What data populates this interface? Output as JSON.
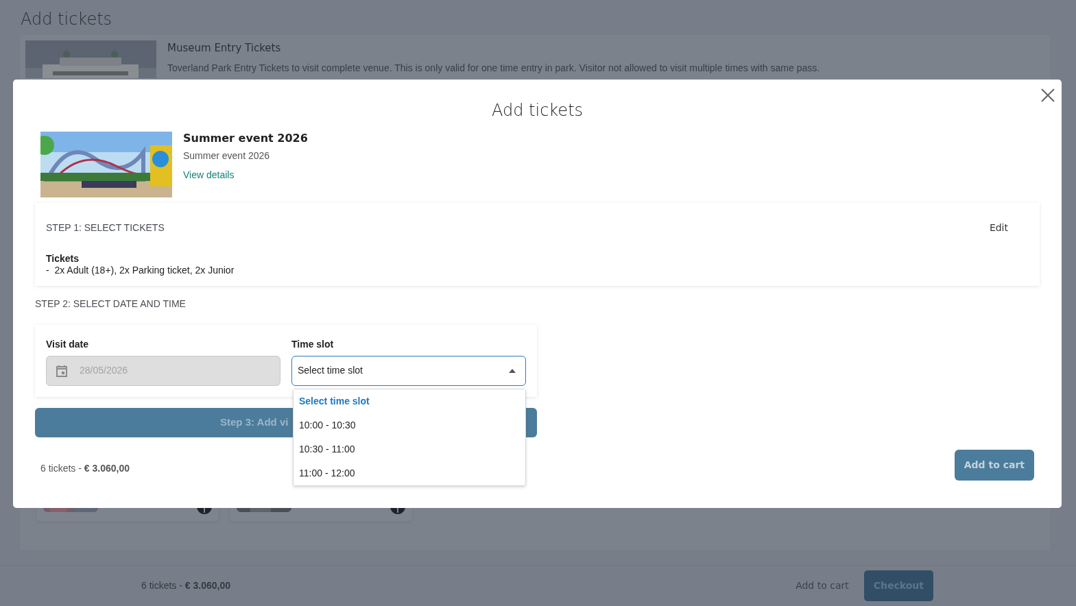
{
  "page": {
    "title": "Add tickets",
    "product": {
      "title": "Museum Entry Tickets",
      "description": "Toverland Park Entry Tickets to visit complete venue. This is only valid for one time entry in park. Visitor not allowed to visit multiple times with same pass."
    }
  },
  "bottom_bar": {
    "summary": "6 tickets - **€ 3.060,00**",
    "add_to_cart": "Add to cart",
    "checkout": "Checkout"
  },
  "modal": {
    "title": "Add tickets",
    "event": {
      "title": "Summer event 2026",
      "subtitle": "Summer event 2026",
      "link": "View details"
    },
    "step1": {
      "heading": "STEP 1: SELECT TICKETS",
      "edit": "Edit",
      "label": "Tickets",
      "summary": "-  2x Adult (18+), 2x Parking ticket, 2x Junior"
    },
    "step2": {
      "heading": "STEP 2: SELECT DATE AND TIME",
      "visit_date": {
        "label": "Visit date",
        "value": "28/05/2026",
        "disabled": true
      },
      "time_slot": {
        "label": "Time slot",
        "value": "Select time slot",
        "expanded": true,
        "options": [
          {
            "label": "Select time slot",
            "selected": true
          },
          {
            "label": "10:00 - 10:30",
            "selected": false
          },
          {
            "label": "10:30 - 11:00",
            "selected": false
          },
          {
            "label": "11:00 - 12:00",
            "selected": false
          }
        ]
      }
    },
    "step3_button": "Step 3: Add vi",
    "summary": "6 tickets - **€ 3.060,00**",
    "add_to_cart": "Add to cart"
  }
}
